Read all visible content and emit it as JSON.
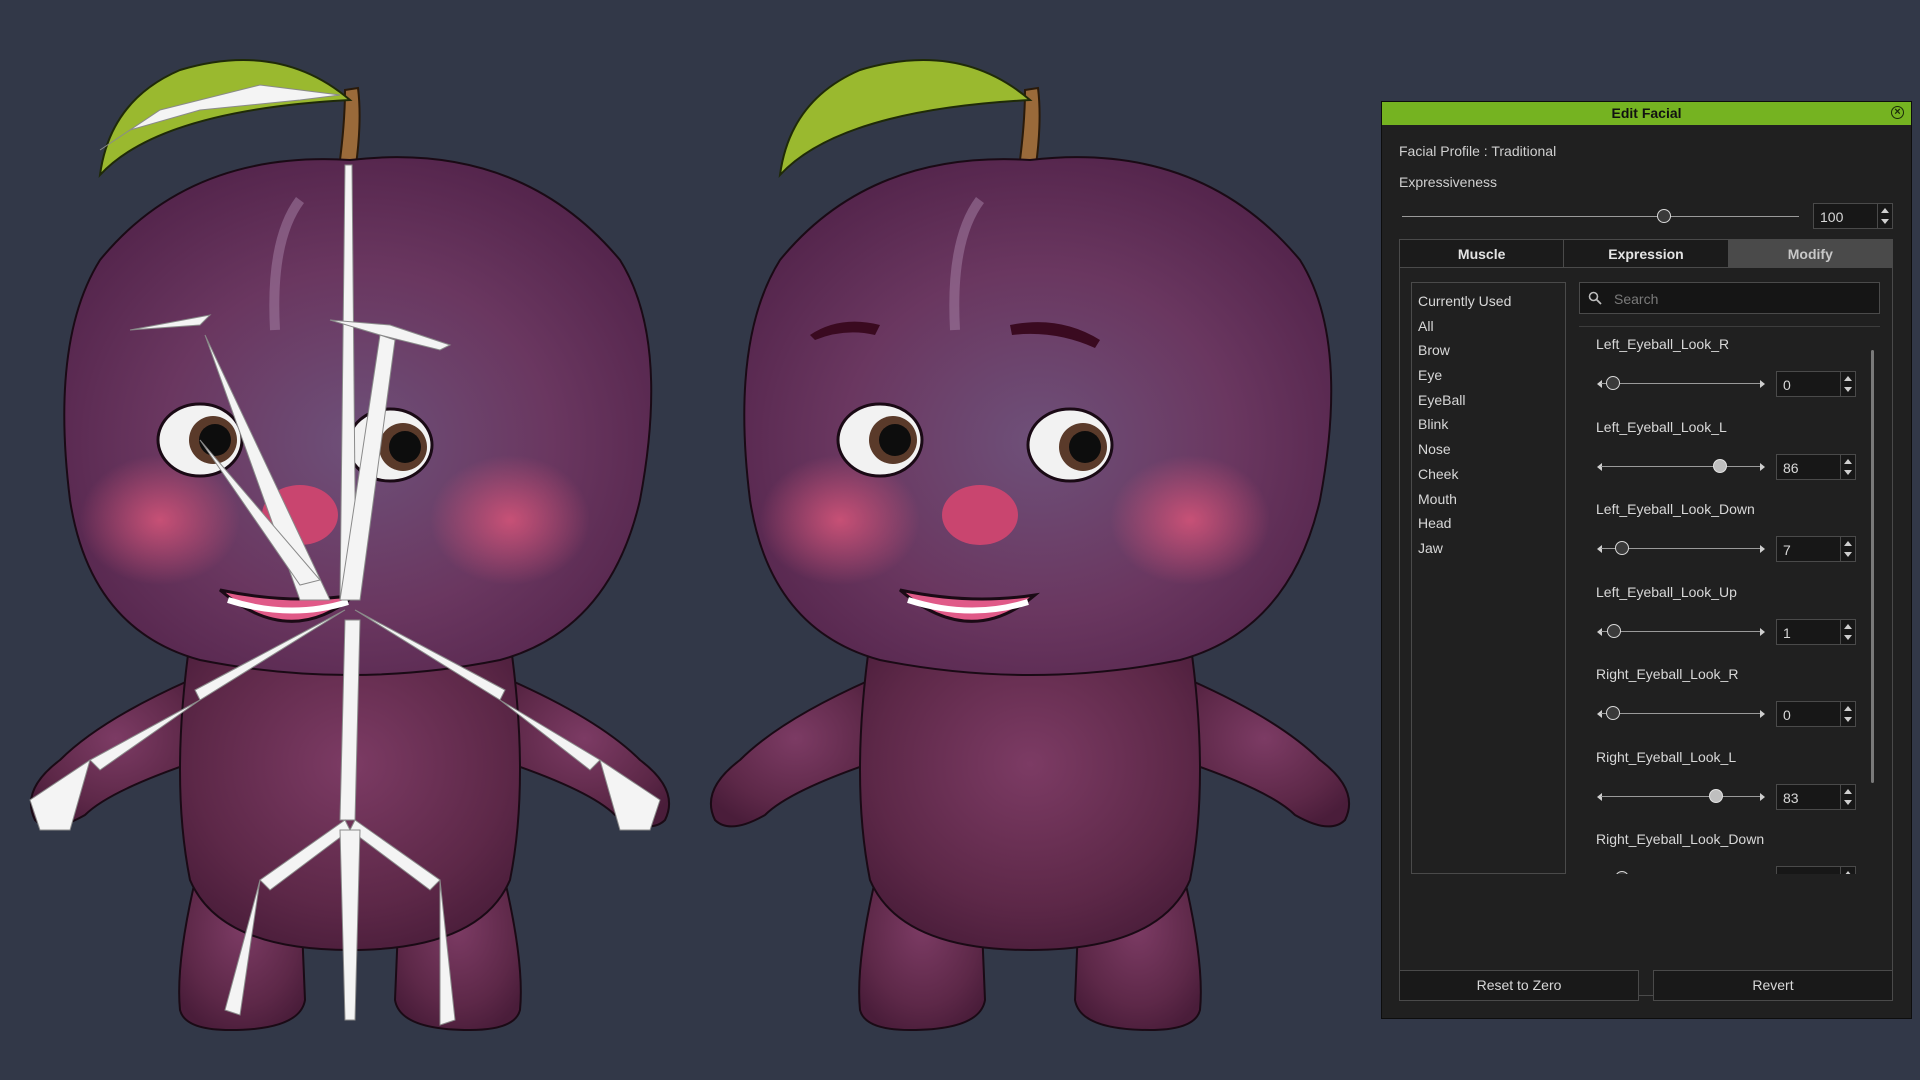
{
  "panel": {
    "title": "Edit Facial",
    "facial_profile": "Facial Profile : Traditional",
    "expressiveness_label": "Expressiveness",
    "expressiveness_value": "100",
    "expressiveness_fraction": 0.66,
    "tabs": [
      {
        "label": "Muscle",
        "active": false
      },
      {
        "label": "Expression",
        "active": false
      },
      {
        "label": "Modify",
        "active": true
      }
    ],
    "categories": [
      "Currently Used",
      "All",
      "Brow",
      "Eye",
      "EyeBall",
      "Blink",
      "Nose",
      "Cheek",
      "Mouth",
      "Head",
      "Jaw"
    ],
    "search_placeholder": "Search",
    "morphs": [
      {
        "name": "Left_Eyeball_Look_R",
        "value": "0",
        "fraction": 0.0
      },
      {
        "name": "Left_Eyeball_Look_L",
        "value": "86",
        "fraction": 0.86
      },
      {
        "name": "Left_Eyeball_Look_Down",
        "value": "7",
        "fraction": 0.07
      },
      {
        "name": "Left_Eyeball_Look_Up",
        "value": "1",
        "fraction": 0.01
      },
      {
        "name": "Right_Eyeball_Look_R",
        "value": "0",
        "fraction": 0.0
      },
      {
        "name": "Right_Eyeball_Look_L",
        "value": "83",
        "fraction": 0.83
      },
      {
        "name": "Right_Eyeball_Look_Down",
        "value": "",
        "fraction": 0.07
      }
    ],
    "reset_label": "Reset to Zero",
    "revert_label": "Revert"
  },
  "colors": {
    "accent": "#75b321",
    "background": "#323848",
    "panel": "#202020",
    "plum": "#6b2f55",
    "leaf": "#9ab92f"
  },
  "icons": [
    "close-icon",
    "search-icon",
    "slider-arrow-icon",
    "spinner-arrow-icon"
  ]
}
